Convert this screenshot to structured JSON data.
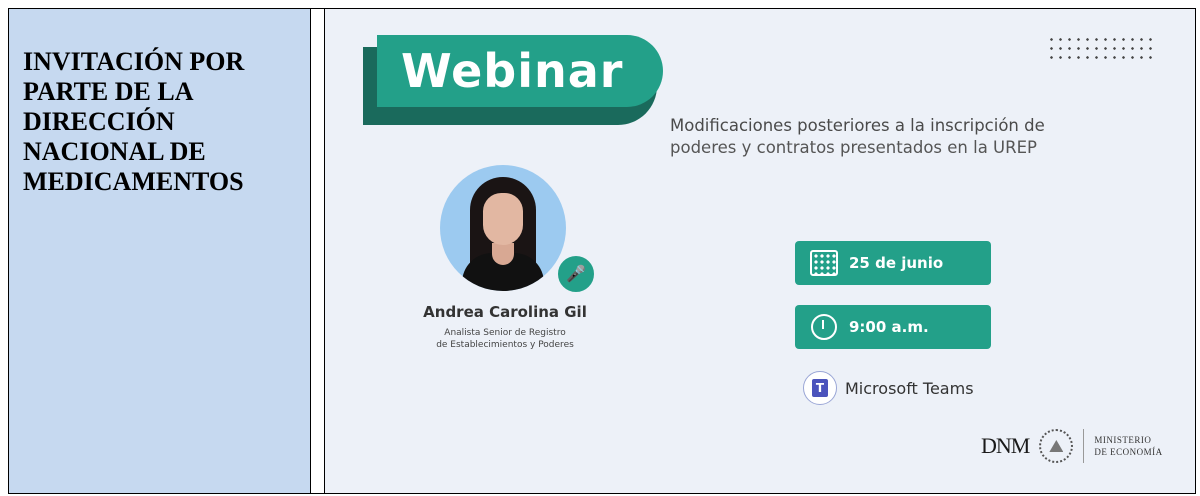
{
  "left_panel": {
    "heading": "INVITACIÓN POR PARTE DE LA DIRECCIÓN NACIONAL DE MEDICAMENTOS"
  },
  "flyer": {
    "banner": "Webinar",
    "subtitle_line1": "Modificaciones posteriores a la inscripción de",
    "subtitle_line2": "poderes y contratos presentados en la UREP",
    "speaker_name": "Andrea Carolina Gil",
    "speaker_role_line1": "Analista Senior de Registro",
    "speaker_role_line2": "de Establecimientos y Poderes",
    "date": "25 de junio",
    "time": "9:00 a.m.",
    "platform": "Microsoft Teams",
    "logo_dnm": "DNM",
    "ministry_line1": "MINISTERIO",
    "ministry_line2": "DE ECONOMÍA"
  },
  "colors": {
    "accent": "#23a089",
    "accent_dark": "#1a6a5c",
    "left_bg": "#c6d9f0",
    "flyer_bg": "#edf1f8"
  }
}
